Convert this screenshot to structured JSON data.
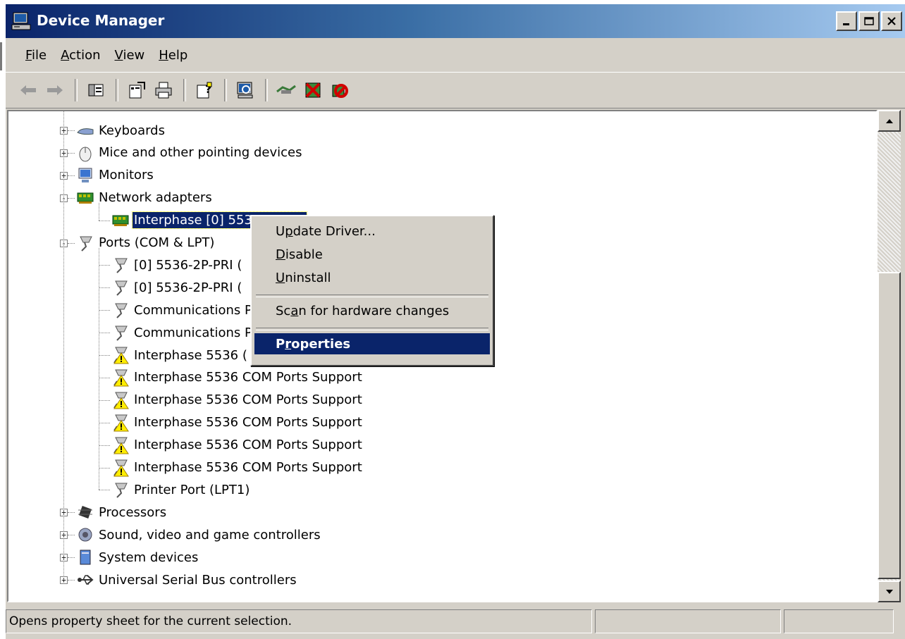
{
  "window": {
    "title": "Device Manager"
  },
  "menu": [
    {
      "label": "File",
      "key": "F",
      "rest": "ile"
    },
    {
      "label": "Action",
      "key": "A",
      "rest": "ction"
    },
    {
      "label": "View",
      "key": "V",
      "rest": "iew"
    },
    {
      "label": "Help",
      "key": "H",
      "rest": "elp"
    }
  ],
  "toolbar_icons": [
    "back-arrow-icon",
    "forward-arrow-icon",
    "show-hide-tree-icon",
    "properties-icon",
    "print-icon",
    "help-icon",
    "scan-hardware-icon",
    "update-driver-icon",
    "uninstall-icon",
    "disable-icon"
  ],
  "tree": [
    {
      "label": "Keyboards",
      "icon": "keyboard-icon",
      "level": 0,
      "expander": "+"
    },
    {
      "label": "Mice and other pointing devices",
      "icon": "mouse-icon",
      "level": 0,
      "expander": "+"
    },
    {
      "label": "Monitors",
      "icon": "monitor-icon",
      "level": 0,
      "expander": "+"
    },
    {
      "label": "Network adapters",
      "icon": "network-card-icon",
      "level": 0,
      "expander": "-"
    },
    {
      "label": "Interphase [0] 5536-2P-PRI",
      "icon": "network-card-icon",
      "level": 1,
      "selected": true
    },
    {
      "label": "Ports (COM & LPT)",
      "icon": "port-icon",
      "level": 0,
      "expander": "-"
    },
    {
      "label": "[0] 5536-2P-PRI (",
      "icon": "port-icon",
      "level": 1
    },
    {
      "label": "[0] 5536-2P-PRI (",
      "icon": "port-icon",
      "level": 1
    },
    {
      "label": "Communications P",
      "icon": "port-icon",
      "level": 1
    },
    {
      "label": "Communications P",
      "icon": "port-icon",
      "level": 1
    },
    {
      "label": "Interphase 5536 (",
      "icon": "port-warning-icon",
      "level": 1
    },
    {
      "label": "Interphase 5536 COM Ports Support",
      "icon": "port-warning-icon",
      "level": 1
    },
    {
      "label": "Interphase 5536 COM Ports Support",
      "icon": "port-warning-icon",
      "level": 1
    },
    {
      "label": "Interphase 5536 COM Ports Support",
      "icon": "port-warning-icon",
      "level": 1
    },
    {
      "label": "Interphase 5536 COM Ports Support",
      "icon": "port-warning-icon",
      "level": 1
    },
    {
      "label": "Interphase 5536 COM Ports Support",
      "icon": "port-warning-icon",
      "level": 1
    },
    {
      "label": "Printer Port (LPT1)",
      "icon": "port-icon",
      "level": 1
    },
    {
      "label": "Processors",
      "icon": "processor-icon",
      "level": 0,
      "expander": "+"
    },
    {
      "label": "Sound, video and game controllers",
      "icon": "speaker-icon",
      "level": 0,
      "expander": "+"
    },
    {
      "label": "System devices",
      "icon": "system-icon",
      "level": 0,
      "expander": "+"
    },
    {
      "label": "Universal Serial Bus controllers",
      "icon": "usb-icon",
      "level": 0,
      "expander": "+"
    }
  ],
  "context_menu": [
    {
      "pre": "U",
      "key": "p",
      "post": "date Driver...",
      "label": "Update Driver..."
    },
    {
      "pre": "",
      "key": "D",
      "post": "isable",
      "label": "Disable"
    },
    {
      "pre": "",
      "key": "U",
      "post": "ninstall",
      "label": "Uninstall"
    },
    {
      "sep": true
    },
    {
      "pre": "Sc",
      "key": "a",
      "post": "n for hardware changes",
      "label": "Scan for hardware changes"
    },
    {
      "sep": true
    },
    {
      "pre": "P",
      "key": "r",
      "post": "operties",
      "label": "Properties",
      "active": true
    }
  ],
  "status": {
    "text": "Opens property sheet for the current selection.",
    "panel2": "",
    "panel3": ""
  },
  "colors": {
    "title_start": "#0a246a",
    "title_end": "#a6caf0",
    "selection": "#0a246a",
    "face": "#d4d0c8",
    "warning": "#ffee00"
  }
}
